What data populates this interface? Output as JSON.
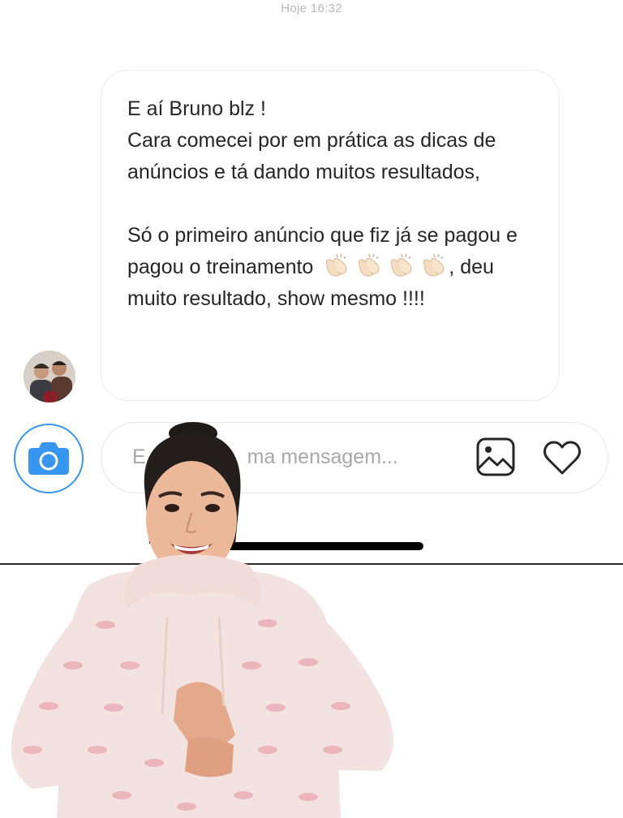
{
  "chat": {
    "timestamp": "Hoje 16:32",
    "message": {
      "line1": "E aí Bruno blz !",
      "line2": "Cara comecei por em prática as dicas de anúncios e tá dando muitos resultados,",
      "line3_before_emoji": "Só o primeiro anúncio que fiz já se pagou e pagou o treinamento",
      "line3_after_emoji": ", deu muito resultado, show mesmo !!!!",
      "emoji": "clapping-hands-emoji"
    }
  },
  "composer": {
    "placeholder": "Escreva uma mensagem...",
    "visible_placeholder": "E          ma mensagem...",
    "camera_icon": "camera-icon",
    "gallery_icon": "gallery-icon",
    "heart_icon": "heart-icon"
  },
  "colors": {
    "accent": "#3797f0",
    "text": "#262626",
    "placeholder": "#a8a8a8",
    "timestamp": "#b8b8b8"
  }
}
